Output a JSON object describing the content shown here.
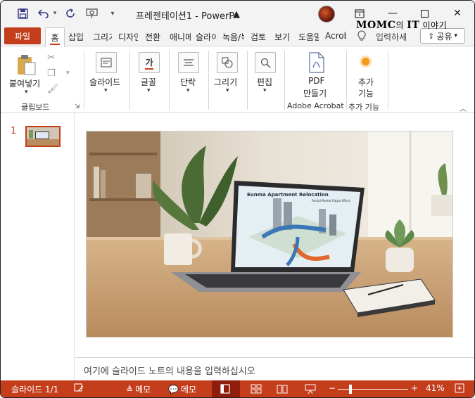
{
  "titlebar": {
    "title": "프레젠테이션1  -  PowerP",
    "watermark_main": "MOMC",
    "watermark_mid": "의 ",
    "watermark_it": "IT",
    "watermark_end": " 이야기"
  },
  "tabs": {
    "file": "파일",
    "home": "홈",
    "items": [
      "삽입",
      "그리기",
      "디자인",
      "전환",
      "애니메이션",
      "슬라이드 쇼",
      "녹음/녹화",
      "검토",
      "보기",
      "도움말",
      "Acrobat"
    ],
    "tell_me": "입력하세",
    "share": "공유"
  },
  "ribbon": {
    "paste": "붙여넣기",
    "clipboard_group": "클립보드",
    "slides": "슬라이드",
    "font": "글꼴",
    "paragraph": "단락",
    "drawing": "그리기",
    "editing": "편집",
    "pdf_line1": "PDF",
    "pdf_line2": "만들기",
    "acrobat_group": "Adobe Acrobat",
    "addins_line1": "추가",
    "addins_line2": "기능",
    "addins_group": "추가 기능"
  },
  "thumbnails": {
    "slide_number": "1"
  },
  "slide": {
    "screen_title": "Eunma Apartment Relocation",
    "screen_subtitle": "Rental Market Ripple Effect"
  },
  "notes": {
    "placeholder": "여기에 슬라이드 노트의 내용을 입력하십시오"
  },
  "statusbar": {
    "slide_count": "슬라이드 1/1",
    "notes1": "메모",
    "notes2": "메모",
    "zoom": "41%"
  },
  "colors": {
    "accent": "#c43e1c",
    "accent_dark": "#8f1d0b"
  }
}
